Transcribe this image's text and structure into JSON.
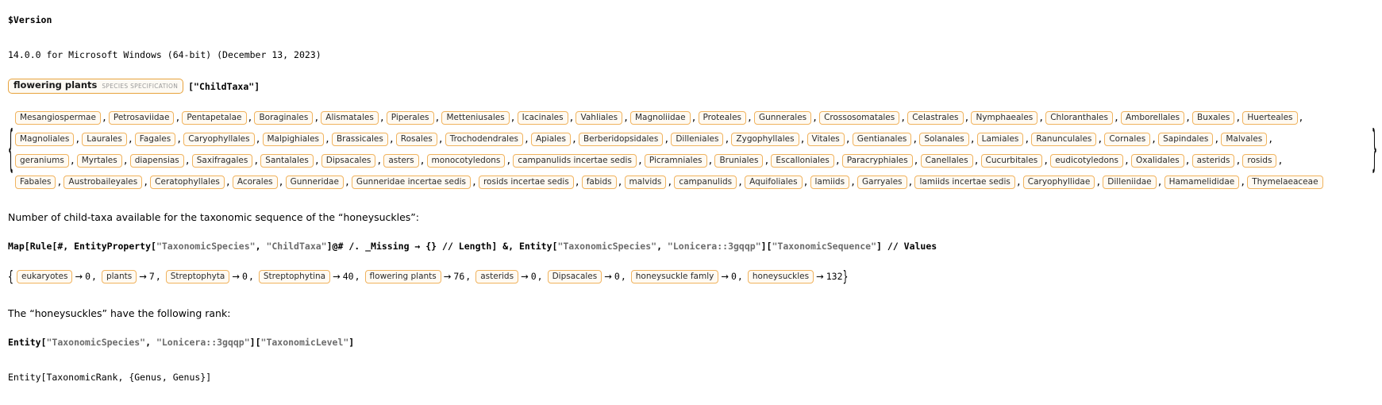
{
  "version_cell": {
    "input": "$Version",
    "output": "14.0.0 for Microsoft Windows (64-bit) (December 13, 2023)"
  },
  "entity_property_cell": {
    "entity_label": "flowering plants",
    "entity_type": "SPECIES SPECIFICATION",
    "property_code": "[\"ChildTaxa\"]"
  },
  "child_taxa_output": {
    "open_brace": "{",
    "close_brace": "}",
    "rows": [
      [
        "Mesangiospermae",
        "Petrosaviidae",
        "Pentapetalae",
        "Boraginales",
        "Alismatales",
        "Piperales",
        "Metteniusales",
        "Icacinales",
        "Vahliales",
        "Magnoliidae",
        "Proteales",
        "Gunnerales",
        "Crossosomatales",
        "Celastrales",
        "Nymphaeales",
        "Chloranthales",
        "Amborellales",
        "Buxales",
        "Huerteales"
      ],
      [
        "Magnoliales",
        "Laurales",
        "Fagales",
        "Caryophyllales",
        "Malpighiales",
        "Brassicales",
        "Rosales",
        "Trochodendrales",
        "Apiales",
        "Berberidopsidales",
        "Dilleniales",
        "Zygophyllales",
        "Vitales",
        "Gentianales",
        "Solanales",
        "Lamiales",
        "Ranunculales",
        "Cornales",
        "Sapindales",
        "Malvales"
      ],
      [
        "geraniums",
        "Myrtales",
        "diapensias",
        "Saxifragales",
        "Santalales",
        "Dipsacales",
        "asters",
        "monocotyledons",
        "campanulids incertae sedis",
        "Picramniales",
        "Bruniales",
        "Escalloniales",
        "Paracryphiales",
        "Canellales",
        "Cucurbitales",
        "eudicotyledons",
        "Oxalidales",
        "asterids",
        "rosids"
      ],
      [
        "Fabales",
        "Austrobaileyales",
        "Ceratophyllales",
        "Acorales",
        "Gunneridae",
        "Gunneridae incertae sedis",
        "rosids incertae sedis",
        "fabids",
        "malvids",
        "campanulids",
        "Aquifoliales",
        "lamiids",
        "Garryales",
        "lamiids incertae sedis",
        "Caryophyllidae",
        "Dilleniidae",
        "Hamamelididae",
        "Thymelaeaceae"
      ]
    ]
  },
  "prose_1": "Number of child-taxa available for the taxonomic sequence of the “honeysuckles”:",
  "code_1": {
    "segments": [
      {
        "t": "Map[Rule[",
        "c": "sym"
      },
      {
        "t": "#",
        "c": "slot"
      },
      {
        "t": ", EntityProperty[",
        "c": "sym"
      },
      {
        "t": "\"TaxonomicSpecies\"",
        "c": "str"
      },
      {
        "t": ", ",
        "c": "sym"
      },
      {
        "t": "\"ChildTaxa\"",
        "c": "str"
      },
      {
        "t": "]@",
        "c": "sym"
      },
      {
        "t": "#",
        "c": "slot"
      },
      {
        "t": " /. _Missing → {} // Length] &, Entity[",
        "c": "sym"
      },
      {
        "t": "\"TaxonomicSpecies\"",
        "c": "str"
      },
      {
        "t": ", ",
        "c": "sym"
      },
      {
        "t": "\"Lonicera::3gqqp\"",
        "c": "str"
      },
      {
        "t": "][",
        "c": "sym"
      },
      {
        "t": "\"TaxonomicSequence\"",
        "c": "str"
      },
      {
        "t": "] // Values",
        "c": "sym"
      }
    ]
  },
  "rules_output": {
    "open_brace": "{",
    "close_brace": "}",
    "arrow": "→",
    "items": [
      {
        "label": "eukaryotes",
        "value": "0"
      },
      {
        "label": "plants",
        "value": "7"
      },
      {
        "label": "Streptophyta",
        "value": "0"
      },
      {
        "label": "Streptophytina",
        "value": "40"
      },
      {
        "label": "flowering plants",
        "value": "76"
      },
      {
        "label": "asterids",
        "value": "0"
      },
      {
        "label": "Dipsacales",
        "value": "0"
      },
      {
        "label": "honeysuckle famly",
        "value": "0"
      },
      {
        "label": "honeysuckles",
        "value": "132"
      }
    ]
  },
  "prose_2": "The “honeysuckles” have the following rank:",
  "code_2": {
    "segments": [
      {
        "t": "Entity[",
        "c": "sym"
      },
      {
        "t": "\"TaxonomicSpecies\"",
        "c": "str"
      },
      {
        "t": ", ",
        "c": "sym"
      },
      {
        "t": "\"Lonicera::3gqqp\"",
        "c": "str"
      },
      {
        "t": "][",
        "c": "sym"
      },
      {
        "t": "\"TaxonomicLevel\"",
        "c": "str"
      },
      {
        "t": "]",
        "c": "sym"
      }
    ]
  },
  "output_2": "Entity[TaxonomicRank, {Genus, Genus}]",
  "colors": {
    "entity_border": "#e8a33d",
    "chip_border": "#f0b35e",
    "chip_background": "#fffaf2",
    "string_text": "#6b6b6b",
    "type_label": "#9a9a9a",
    "background": "#ffffff"
  }
}
